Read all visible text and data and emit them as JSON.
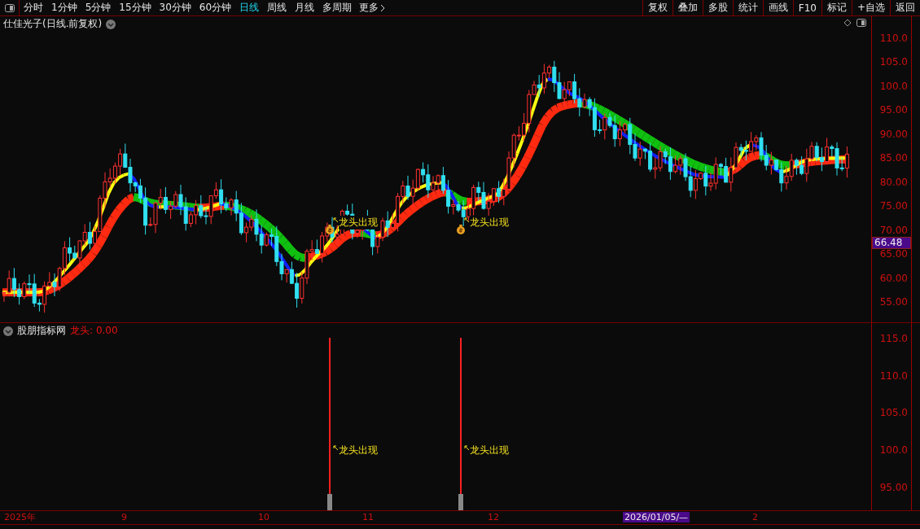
{
  "toolbar": {
    "periods": [
      {
        "label": "分时",
        "selected": false
      },
      {
        "label": "1分钟",
        "selected": false
      },
      {
        "label": "5分钟",
        "selected": false
      },
      {
        "label": "15分钟",
        "selected": false
      },
      {
        "label": "30分钟",
        "selected": false
      },
      {
        "label": "60分钟",
        "selected": false
      },
      {
        "label": "日线",
        "selected": true
      },
      {
        "label": "周线",
        "selected": false
      },
      {
        "label": "月线",
        "selected": false
      },
      {
        "label": "多周期",
        "selected": false
      }
    ],
    "more": "更多",
    "actions": [
      "复权",
      "叠加",
      "多股",
      "统计",
      "画线",
      "F10",
      "标记",
      "+自选",
      "返回"
    ]
  },
  "price_panel": {
    "title": "仕佳光子(日线.前复权)",
    "y_ticks": [
      "110.0",
      "105.0",
      "100.0",
      "95.00",
      "90.00",
      "85.00",
      "80.00",
      "75.00",
      "70.00",
      "65.00",
      "60.00",
      "55.00"
    ],
    "current_price": "66.48",
    "signals": [
      "龙头出现",
      "龙头出现"
    ]
  },
  "indicator_panel": {
    "name": "股朋指标网",
    "series_label": "龙头:",
    "series_value": "0.00",
    "y_ticks": [
      "115.0",
      "110.0",
      "105.0",
      "100.0",
      "95.00"
    ],
    "signals": [
      "龙头出现",
      "龙头出现"
    ]
  },
  "time_axis": {
    "labels": [
      {
        "label": "2025年",
        "selected": false
      },
      {
        "label": "9",
        "selected": false
      },
      {
        "label": "10",
        "selected": false
      },
      {
        "label": "11",
        "selected": false
      },
      {
        "label": "12",
        "selected": false
      },
      {
        "label": "2026/01/05/—",
        "selected": true
      },
      {
        "label": "2",
        "selected": false
      }
    ]
  }
}
